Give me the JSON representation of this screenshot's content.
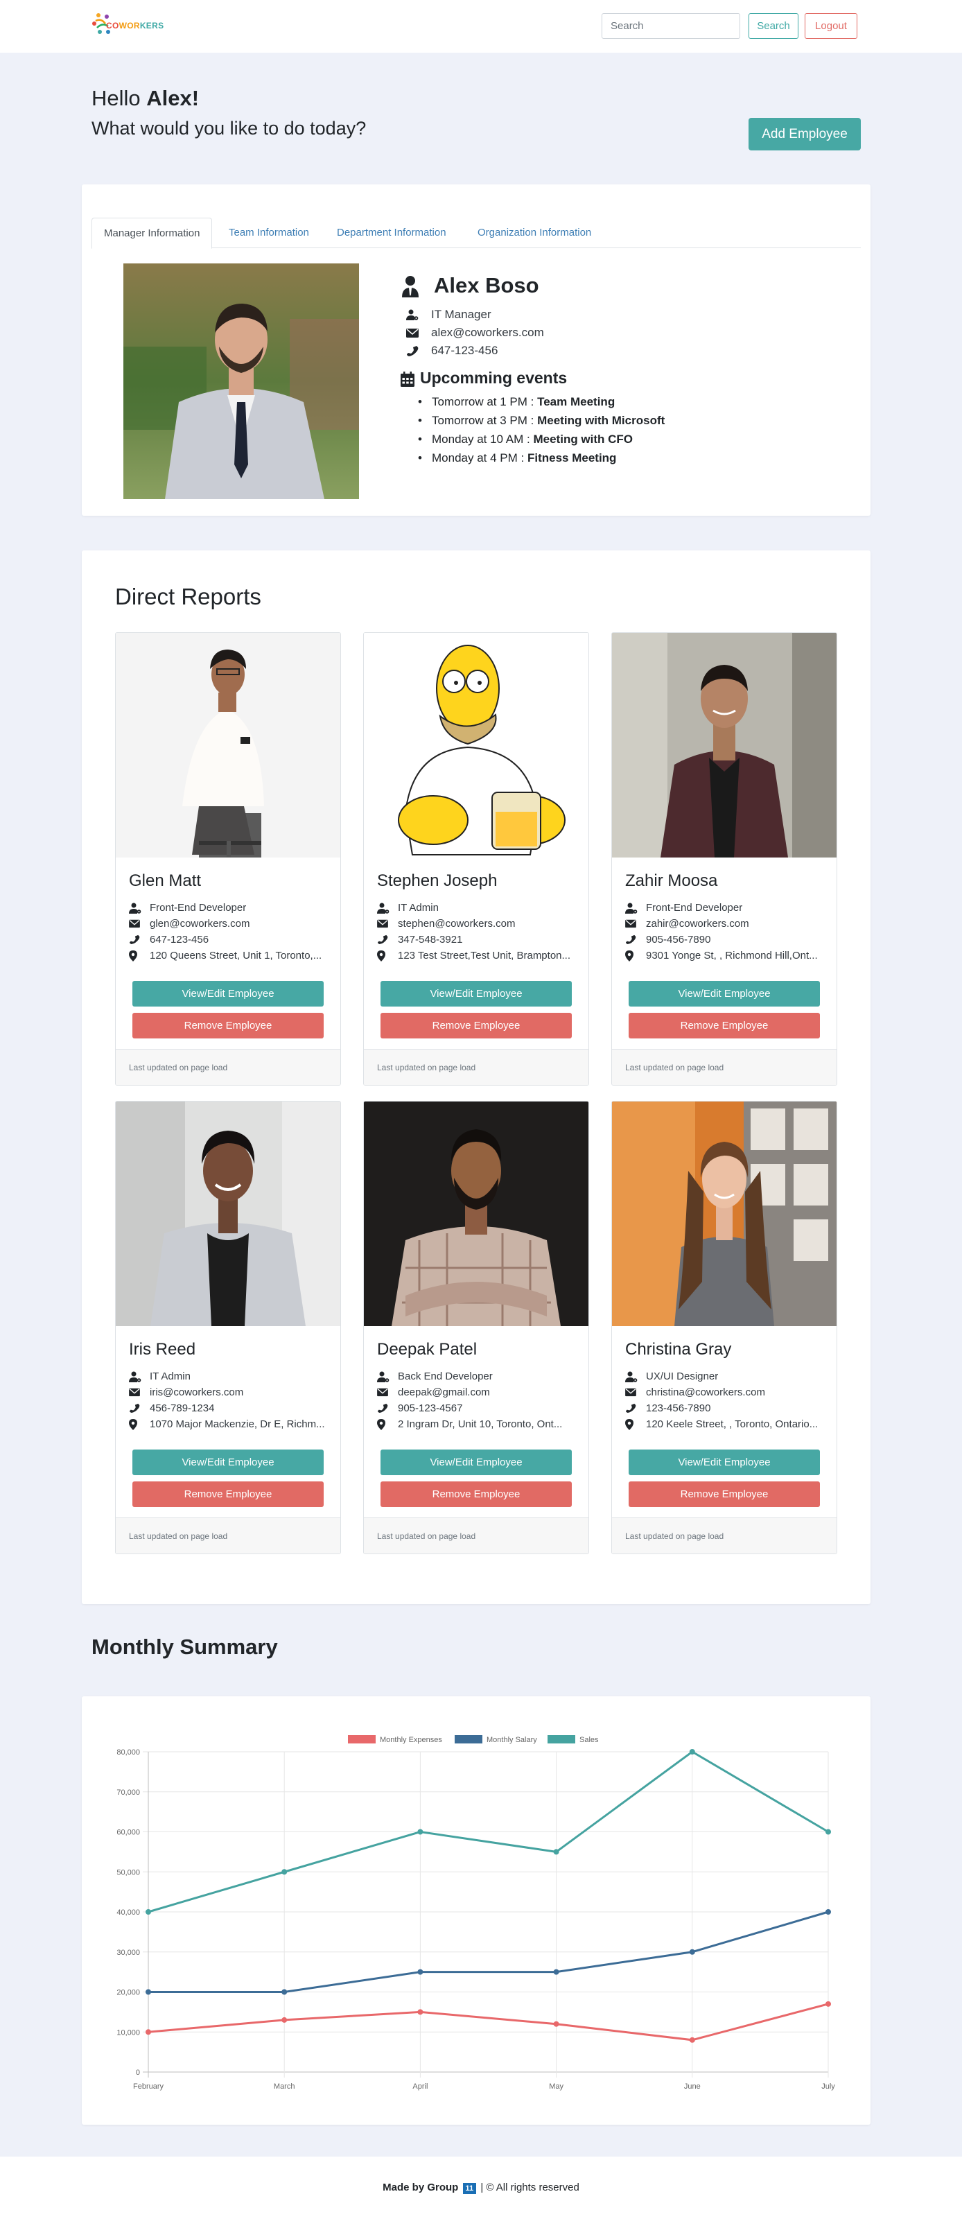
{
  "nav": {
    "logo_text": "COWORKERS",
    "search_placeholder": "Search",
    "search_button": "Search",
    "logout_button": "Logout"
  },
  "greeting": {
    "hello": "Hello",
    "name": "Alex!",
    "question": "What would you like to do today?",
    "add_button": "Add Employee"
  },
  "tabs": [
    "Manager Information",
    "Team Information",
    "Department Information",
    "Organization Information"
  ],
  "manager": {
    "name": "Alex Boso",
    "title": "IT Manager",
    "email": "alex@coworkers.com",
    "phone": "647-123-456",
    "events_title": "Upcomming events",
    "events": [
      {
        "when": "Tomorrow at 1 PM :",
        "what": "Team Meeting"
      },
      {
        "when": "Tomorrow at 3 PM :",
        "what": "Meeting with Microsoft"
      },
      {
        "when": "Monday at 10 AM :",
        "what": "Meeting with CFO"
      },
      {
        "when": "Monday at 4 PM :",
        "what": "Fitness Meeting"
      }
    ]
  },
  "direct_reports": {
    "title": "Direct Reports",
    "view_label": "View/Edit Employee",
    "remove_label": "Remove Employee",
    "footer_label": "Last updated on page load",
    "employees": [
      {
        "name": "Glen Matt",
        "role": "Front-End Developer",
        "email": "glen@coworkers.com",
        "phone": "647-123-456",
        "address": "120 Queens Street, Unit 1, Toronto,..."
      },
      {
        "name": "Stephen Joseph",
        "role": "IT Admin",
        "email": "stephen@coworkers.com",
        "phone": "347-548-3921",
        "address": "123 Test Street,Test Unit, Brampton..."
      },
      {
        "name": "Zahir Moosa",
        "role": "Front-End Developer",
        "email": "zahir@coworkers.com",
        "phone": "905-456-7890",
        "address": "9301 Yonge St, , Richmond Hill,Ont..."
      },
      {
        "name": "Iris Reed",
        "role": "IT Admin",
        "email": "iris@coworkers.com",
        "phone": "456-789-1234",
        "address": "1070 Major Mackenzie, Dr E, Richm..."
      },
      {
        "name": "Deepak Patel",
        "role": "Back End Developer",
        "email": "deepak@gmail.com",
        "phone": "905-123-4567",
        "address": "2 Ingram Dr, Unit 10, Toronto, Ont..."
      },
      {
        "name": "Christina Gray",
        "role": "UX/UI Designer",
        "email": "christina@coworkers.com",
        "phone": "123-456-7890",
        "address": "120 Keele Street, , Toronto, Ontario..."
      }
    ]
  },
  "summary": {
    "title": "Monthly Summary"
  },
  "chart_data": {
    "type": "line",
    "categories": [
      "February",
      "March",
      "April",
      "May",
      "June",
      "July"
    ],
    "series": [
      {
        "name": "Monthly Expenses",
        "color": "#e8686a",
        "values": [
          10000,
          13000,
          15000,
          12000,
          8000,
          17000
        ]
      },
      {
        "name": "Monthly Salary",
        "color": "#3c6c96",
        "values": [
          20000,
          20000,
          25000,
          25000,
          30000,
          40000
        ]
      },
      {
        "name": "Sales",
        "color": "#45a3a0",
        "values": [
          40000,
          50000,
          60000,
          55000,
          80000,
          60000
        ]
      }
    ],
    "ylim": [
      0,
      80000
    ],
    "yticks": [
      "0",
      "10,000",
      "20,000",
      "30,000",
      "40,000",
      "50,000",
      "60,000",
      "70,000",
      "80,000"
    ],
    "grid": true,
    "legend": "top-center"
  },
  "footer": {
    "made_by": "Made by Group",
    "group_num": "11",
    "rights": "| © All rights reserved"
  }
}
